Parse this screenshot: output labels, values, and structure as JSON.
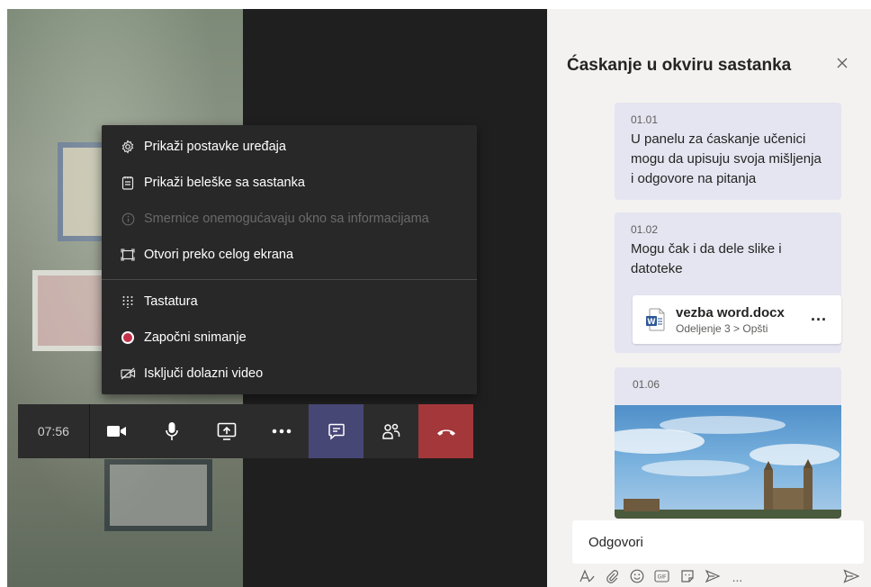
{
  "menu": {
    "items": [
      {
        "label": "Prikaži postavke uređaja",
        "icon": "gear-icon",
        "disabled": false
      },
      {
        "label": "Prikaži beleške sa sastanka",
        "icon": "notes-icon",
        "disabled": false
      },
      {
        "label": "Smernice onemogućavaju okno sa informacijama",
        "icon": "info-icon",
        "disabled": true
      },
      {
        "label": "Otvori preko celog ekrana",
        "icon": "fullscreen-icon",
        "disabled": false
      },
      {
        "label": "Tastatura",
        "icon": "keypad-icon",
        "disabled": false
      },
      {
        "label": "Započni snimanje",
        "icon": "record-icon",
        "disabled": false
      },
      {
        "label": "Isključi dolazni video",
        "icon": "video-off-icon",
        "disabled": false
      }
    ]
  },
  "controls": {
    "timer": "07:56",
    "accent": "#464775",
    "hangup_color": "#a4373a"
  },
  "chat": {
    "title": "Ćaskanje u okviru sastanka",
    "messages": [
      {
        "time": "01.01",
        "text": "U panelu za ćaskanje učenici mogu da upisuju svoja mišljenja i odgovore na pitanja"
      },
      {
        "time": "01.02",
        "text": "Mogu čak i da dele slike i datoteke",
        "file": {
          "name": "vezba word.docx",
          "path": "Odeljenje 3 > Opšti",
          "more": "..."
        }
      },
      {
        "time": "01.06"
      }
    ],
    "compose_placeholder": "Odgovori",
    "toolbar_more": "...",
    "message_bg": "#e5e5f1"
  }
}
